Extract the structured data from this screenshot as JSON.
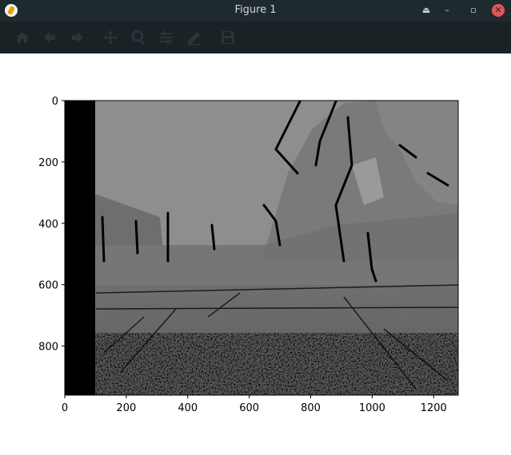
{
  "window": {
    "title": "Figure 1",
    "buttons": [
      "eject-icon",
      "minimize-icon",
      "restore-icon",
      "close-icon"
    ]
  },
  "toolbar": {
    "tools": [
      "home-icon",
      "back-arrow-icon",
      "forward-arrow-icon",
      "pan-icon",
      "zoom-icon",
      "configure-subplots-icon",
      "edit-axes-icon",
      "save-icon"
    ]
  },
  "chart_data": {
    "type": "heatmap",
    "description_of_values": "grayscale disparity/depth image displayed with imshow",
    "x_ticks": [
      "0",
      "200",
      "400",
      "600",
      "800",
      "1000",
      "1200"
    ],
    "y_ticks": [
      "0",
      "200",
      "400",
      "600",
      "800"
    ],
    "xlim": [
      0,
      1280
    ],
    "ylim": [
      960,
      0
    ],
    "colormap": "gray"
  },
  "colors": {
    "titlebar": "#1f2a2f",
    "toolbar": "#1b2226",
    "close_button": "#e0565b"
  }
}
